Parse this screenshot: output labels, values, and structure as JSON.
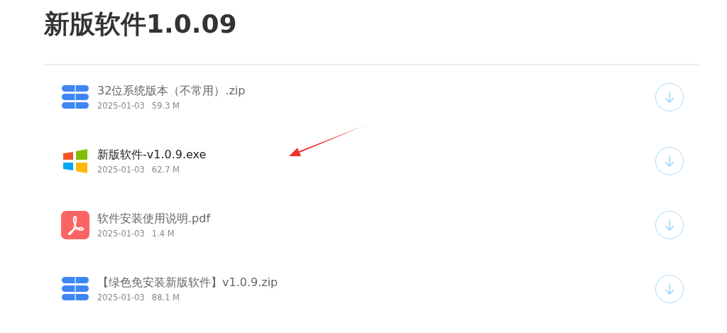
{
  "title": "新版软件1.0.09",
  "files": [
    {
      "kind": "zip",
      "name": "32位系统版本（不常用）.zip",
      "date": "2025-01-03",
      "size": "59.3 M",
      "highlighted": false
    },
    {
      "kind": "exe",
      "name": "新版软件-v1.0.9.exe",
      "date": "2025-01-03",
      "size": "62.7 M",
      "highlighted": true
    },
    {
      "kind": "pdf",
      "name": "软件安装使用说明.pdf",
      "date": "2025-01-03",
      "size": "1.4 M",
      "highlighted": false
    },
    {
      "kind": "zip",
      "name": "【绿色免安装新版软件】v1.0.9.zip",
      "date": "2025-01-03",
      "size": "88.1 M",
      "highlighted": false
    }
  ]
}
